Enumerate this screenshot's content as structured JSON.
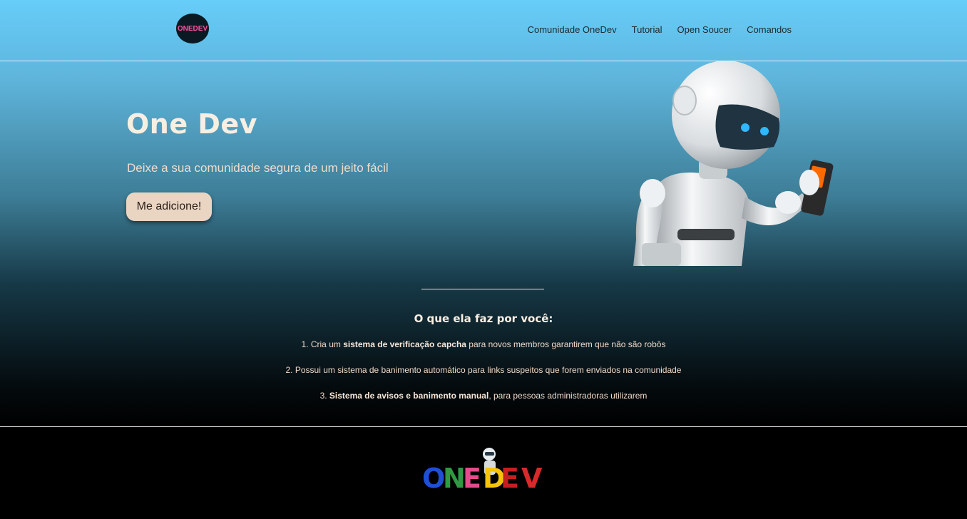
{
  "header": {
    "logo": {
      "text": "ONEDEV",
      "icon": "onedev-logo-icon"
    },
    "nav": [
      {
        "label": "Comunidade OneDev"
      },
      {
        "label": "Tutorial"
      },
      {
        "label": "Open Soucer"
      },
      {
        "label": "Comandos"
      }
    ]
  },
  "hero": {
    "title": "One Dev",
    "subtitle": "Deixe a sua comunidade segura de um jeito fácil",
    "button_label": "Me adicione!",
    "image": "robot-with-phone-image"
  },
  "features": {
    "title": "O que ela faz por você:",
    "items": [
      {
        "prefix": "1. Cria um ",
        "bold": "sistema de verificação capcha",
        "suffix": " para novos membros garantirem que não são robôs"
      },
      {
        "prefix": "2. Possui um sistema de banimento automático para links suspeitos que forem enviados na comunidade",
        "bold": "",
        "suffix": ""
      },
      {
        "prefix": "3. ",
        "bold": "Sistema de avisos e banimento manual",
        "suffix": ", para pessoas administradoras utilizarem"
      }
    ]
  },
  "footer": {
    "logo_text": "ONEDEV",
    "logo_colors": [
      "#1f4fd6",
      "#2f9a43",
      "#e54b8c",
      "#f6c40a",
      "#c71f21",
      "#d92a2a"
    ]
  },
  "colors": {
    "sky": "#66cdf9",
    "button_bg": "#ead5c3",
    "title_text": "#f7efe2",
    "accent_text": "#f1d9c8"
  }
}
